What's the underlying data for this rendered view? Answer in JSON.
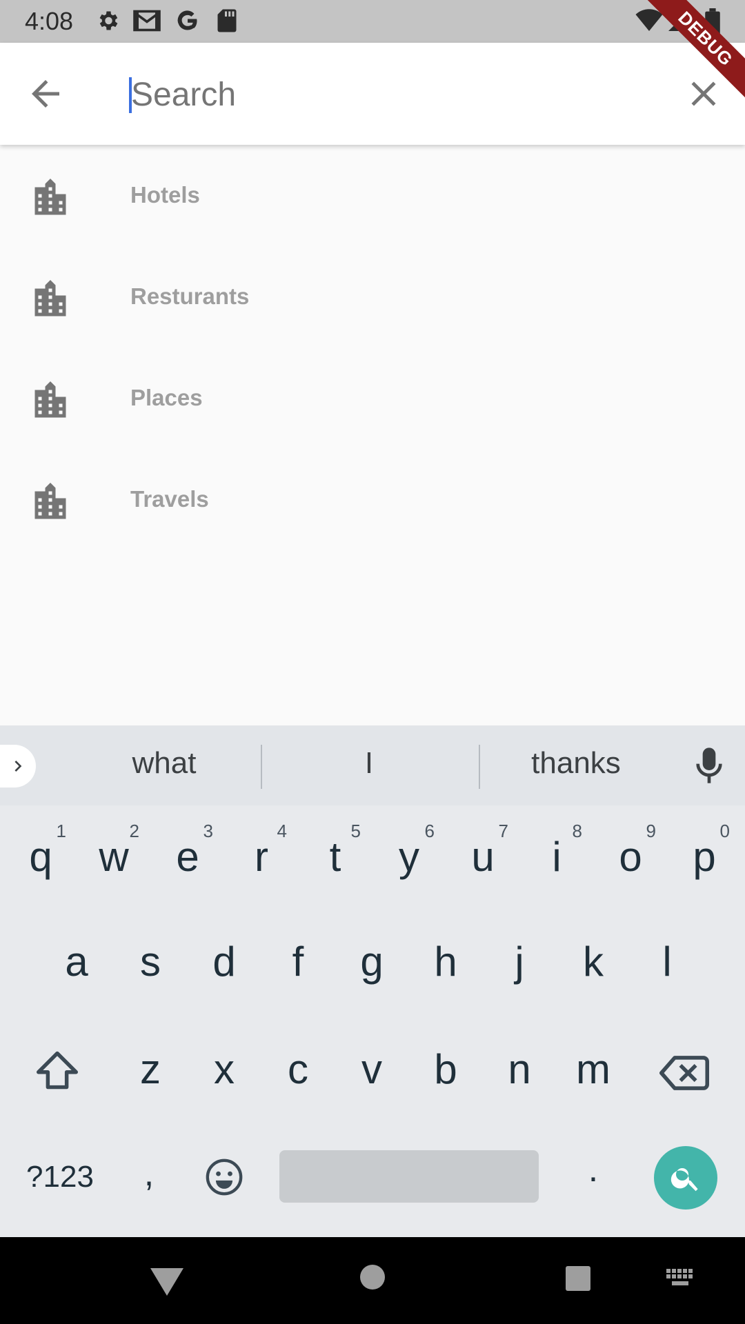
{
  "status_bar": {
    "time": "4:08",
    "icons": [
      "settings-icon",
      "gmail-icon",
      "google-icon",
      "sd-card-icon",
      "wifi-icon",
      "signal-icon",
      "battery-icon"
    ],
    "debug_label": "DEBUG"
  },
  "app_bar": {
    "back_icon": "arrow-back-icon",
    "search_placeholder": "Search",
    "search_value": "",
    "clear_icon": "close-icon"
  },
  "suggestions": [
    {
      "label": "Hotels",
      "icon": "location-city-icon"
    },
    {
      "label": "Resturants",
      "icon": "location-city-icon"
    },
    {
      "label": "Places",
      "icon": "location-city-icon"
    },
    {
      "label": "Travels",
      "icon": "location-city-icon"
    }
  ],
  "keyboard": {
    "word_suggestions": [
      "what",
      "I",
      "thanks"
    ],
    "row1": [
      {
        "key": "q",
        "hint": "1"
      },
      {
        "key": "w",
        "hint": "2"
      },
      {
        "key": "e",
        "hint": "3"
      },
      {
        "key": "r",
        "hint": "4"
      },
      {
        "key": "t",
        "hint": "5"
      },
      {
        "key": "y",
        "hint": "6"
      },
      {
        "key": "u",
        "hint": "7"
      },
      {
        "key": "i",
        "hint": "8"
      },
      {
        "key": "o",
        "hint": "9"
      },
      {
        "key": "p",
        "hint": "0"
      }
    ],
    "row2": [
      "a",
      "s",
      "d",
      "f",
      "g",
      "h",
      "j",
      "k",
      "l"
    ],
    "row3": [
      "z",
      "x",
      "c",
      "v",
      "b",
      "n",
      "m"
    ],
    "symbols_label": "?123",
    "comma_label": ",",
    "period_label": ".",
    "accent_color": "#43b5aa"
  },
  "nav_bar": {
    "buttons": [
      "back-triangle-icon",
      "home-circle-icon",
      "recents-square-icon",
      "keyboard-icon"
    ]
  }
}
